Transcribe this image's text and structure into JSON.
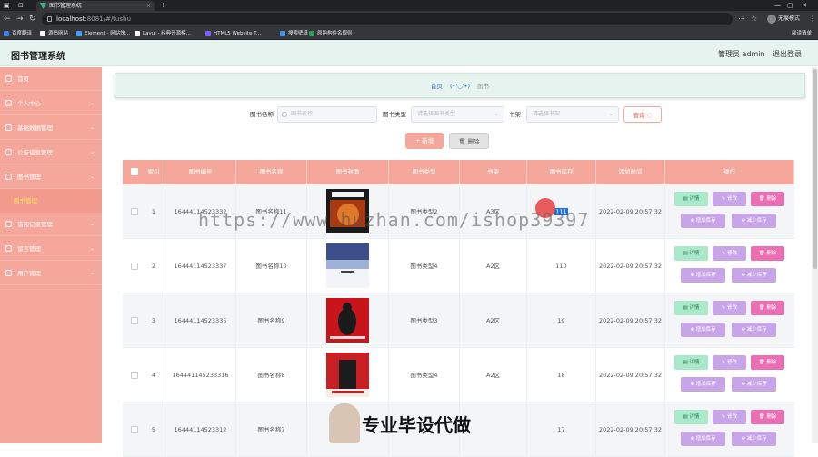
{
  "browser": {
    "tab_title": "图书管理系统",
    "tab_close": "×",
    "new_tab": "+",
    "url_host": "localhost",
    "url_rest": ":8081/#/tushu",
    "profile_label": "无痕模式",
    "bookmarks": [
      {
        "label": "百度翻译",
        "color": "#3e7be6"
      },
      {
        "label": "源码网站",
        "color": "#ffffff"
      },
      {
        "label": "Element - 网站快...",
        "color": "#409eff"
      },
      {
        "label": "Layui - 经典开源模...",
        "color": "#ffffff"
      },
      {
        "label": "HTML5 Website T...",
        "color": "#7b61ff"
      },
      {
        "label": "搜索壁纸",
        "color": "#4a90e2"
      },
      {
        "label": "原始构件名规则",
        "color": "#2e9d5b"
      }
    ],
    "reading_list": "阅读清单"
  },
  "header": {
    "title": "图书管理系统",
    "user": "管理员 admin",
    "logout": "退出登录"
  },
  "sidebar": {
    "items": [
      {
        "label": "首页",
        "icon": "home-icon"
      },
      {
        "label": "个人中心",
        "icon": "user-icon"
      },
      {
        "label": "基础数据管理",
        "icon": "grid-icon"
      },
      {
        "label": "公告信息管理",
        "icon": "notice-icon"
      },
      {
        "label": "图书管理",
        "icon": "book-icon"
      },
      {
        "label": "借阅记录管理",
        "icon": "record-icon"
      },
      {
        "label": "留言管理",
        "icon": "message-icon"
      },
      {
        "label": "用户管理",
        "icon": "users-icon"
      }
    ],
    "active_sub": "图书管理"
  },
  "breadcrumb": {
    "home": "首页",
    "face": "(•'◡'•)",
    "current": "图书"
  },
  "search": {
    "name_label": "图书名称",
    "name_placeholder": "图书名称",
    "type_label": "图书类型",
    "type_placeholder": "请选择图书类型",
    "shelf_label": "书架",
    "shelf_placeholder": "请选择书架",
    "query_button": "查询 ◌"
  },
  "toolbar": {
    "add_button": "+ 新增",
    "delete_button": "🗑 删除"
  },
  "table": {
    "columns": [
      "索引",
      "图书编号",
      "图书名称",
      "图书封面",
      "图书类型",
      "书架",
      "图书库存",
      "添加时间",
      "操作"
    ],
    "rows": [
      {
        "index": "1",
        "code": "16444114523332",
        "name": "图书名称11",
        "type": "图书类型2",
        "shelf": "A3区",
        "stock": "111",
        "time": "2022-02-09 20:57:32"
      },
      {
        "index": "2",
        "code": "16444114523337",
        "name": "图书名称10",
        "type": "图书类型4",
        "shelf": "A2区",
        "stock": "110",
        "time": "2022-02-09 20:57:32"
      },
      {
        "index": "3",
        "code": "16444114523335",
        "name": "图书名称9",
        "type": "图书类型3",
        "shelf": "A2区",
        "stock": "19",
        "time": "2022-02-09 20:57:32"
      },
      {
        "index": "4",
        "code": "164441145233316",
        "name": "图书名称8",
        "type": "图书类型4",
        "shelf": "A2区",
        "stock": "18",
        "time": "2022-02-09 20:57:32"
      },
      {
        "index": "5",
        "code": "16444114523312",
        "name": "图书名称7",
        "type": "",
        "shelf": "",
        "stock": "17",
        "time": "2022-02-09 20:57:32"
      }
    ],
    "actions": {
      "detail": "详情",
      "edit": "修改",
      "delete": "删除",
      "inc": "增加库存",
      "dec": "减少库存"
    }
  },
  "watermark": {
    "url": "https://www.huzhan.com/ishop39397",
    "slogan": "专业毕设代做"
  },
  "colors": {
    "accent": "#f4a79a",
    "header_bg": "#e6f3ee",
    "detail": "#a9e8c8",
    "edit": "#c8a4e8",
    "delete": "#ea6fb3"
  }
}
